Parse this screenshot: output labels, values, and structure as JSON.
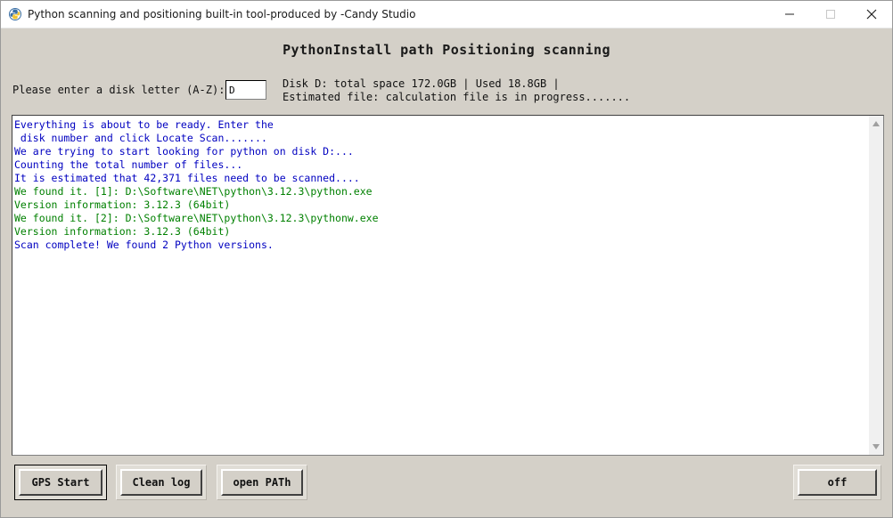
{
  "window": {
    "title": "Python scanning and positioning built-in tool-produced by -Candy Studio",
    "icon": "python-icon"
  },
  "header": {
    "title": "PythonInstall path Positioning scanning"
  },
  "disk_prompt": {
    "label": "Please enter a disk letter (A-Z):",
    "value": "D"
  },
  "disk_info": {
    "line1": "Disk D: total space 172.0GB | Used 18.8GB |",
    "line2": "Estimated file: calculation file is in progress......."
  },
  "log": [
    {
      "text": "Everything is about to be ready. Enter the",
      "color": "blue"
    },
    {
      "text": " disk number and click Locate Scan.......",
      "color": "blue"
    },
    {
      "text": "We are trying to start looking for python on disk D:...",
      "color": "blue"
    },
    {
      "text": "Counting the total number of files...",
      "color": "blue"
    },
    {
      "text": "It is estimated that 42,371 files need to be scanned....",
      "color": "blue"
    },
    {
      "text": "We found it. [1]: D:\\Software\\NET\\python\\3.12.3\\python.exe",
      "color": "green"
    },
    {
      "text": "Version information: 3.12.3 (64bit)",
      "color": "green"
    },
    {
      "text": "We found it. [2]: D:\\Software\\NET\\python\\3.12.3\\pythonw.exe",
      "color": "green"
    },
    {
      "text": "Version information: 3.12.3 (64bit)",
      "color": "green"
    },
    {
      "text": "Scan complete! We found 2 Python versions.",
      "color": "blue"
    }
  ],
  "buttons": {
    "gps_start": "GPS Start",
    "clean_log": "Clean log",
    "open_path": "open PATh",
    "off": "off"
  },
  "colors": {
    "window_bg": "#d4d0c8",
    "log_blue": "#0000c0",
    "log_green": "#008000"
  }
}
